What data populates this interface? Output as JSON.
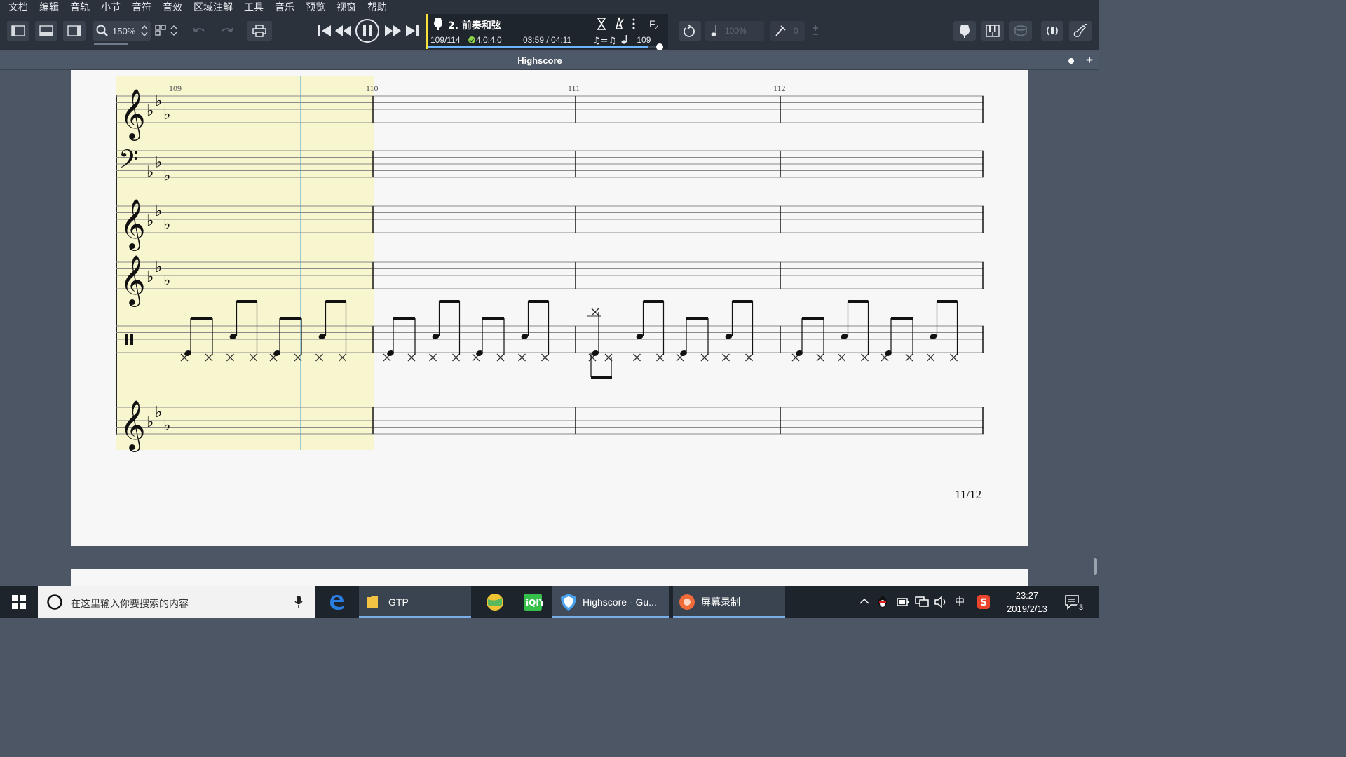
{
  "menu": [
    "文档",
    "编辑",
    "音轨",
    "小节",
    "音符",
    "音效",
    "区域注解",
    "工具",
    "音乐",
    "预览",
    "视窗",
    "帮助"
  ],
  "toolbar": {
    "zoom": "150%",
    "tempo_percent": "100%",
    "tuning_value": "0"
  },
  "transport": {
    "track_name": "2. 前奏和弦",
    "bar_position": "109/114",
    "time_signature": "4.0:4.0",
    "time": "03:59 / 04:11",
    "tempo": "= 109",
    "key": "F",
    "key_octave": "4",
    "progress_fraction": 0.95
  },
  "document": {
    "title": "Highscore"
  },
  "score": {
    "measure_numbers": [
      "109",
      "110",
      "111",
      "112"
    ],
    "page_number": "11/12"
  },
  "taskbar": {
    "search_placeholder": "在这里输入你要搜索的内容",
    "apps": [
      {
        "label": "GTP"
      },
      {
        "label": "Highscore - Gu..."
      },
      {
        "label": "屏幕录制"
      }
    ],
    "ime": "中",
    "time": "23:27",
    "date": "2019/2/13",
    "notifications": "3"
  },
  "colors": {
    "chrome": "#2b323c",
    "lcd_accent": "#f7e23b",
    "playback_highlight": "#f8f6cf",
    "cursor_line": "#7fbcd2"
  }
}
